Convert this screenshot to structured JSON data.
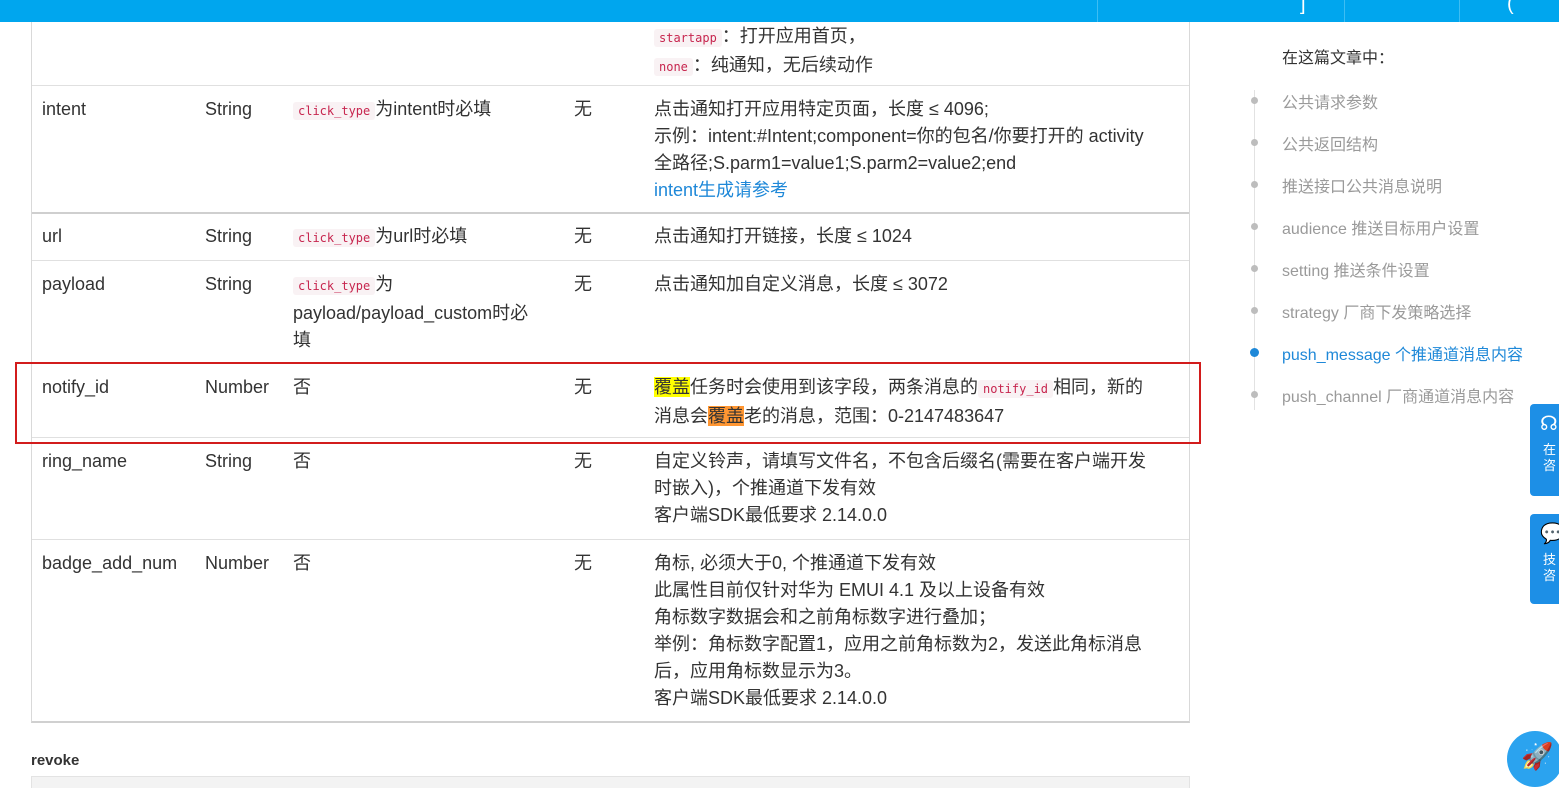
{
  "topbar": {
    "right_glyph_1": "]",
    "right_glyph_2": "("
  },
  "table": {
    "partial_row": {
      "line1_code": "startapp",
      "line1_text": "：打开应用首页，",
      "line2_code": "none",
      "line2_text": "：纯通知，无后续动作"
    },
    "rows": [
      {
        "name": "intent",
        "type": "String",
        "required_code": "click_type",
        "required_text": "为intent时必填",
        "default": "无",
        "desc": [
          "点击通知打开应用特定页面，长度 ≤ 4096;",
          "示例：intent:#Intent;component=你的包名/你要打开的 activity",
          "全路径;S.parm1=value1;S.parm2=value2;end"
        ],
        "link": "intent生成请参考"
      },
      {
        "name": "url",
        "type": "String",
        "required_code": "click_type",
        "required_text": "为url时必填",
        "default": "无",
        "desc": [
          "点击通知打开链接，长度 ≤ 1024"
        ]
      },
      {
        "name": "payload",
        "type": "String",
        "required_code": "click_type",
        "required_text": "为",
        "required_text2": "payload/payload_custom时必",
        "required_text3": "填",
        "default": "无",
        "desc": [
          "点击通知加自定义消息，长度 ≤ 3072"
        ]
      },
      {
        "name": "notify_id",
        "type": "Number",
        "required": "否",
        "default": "无",
        "desc_a": "覆盖",
        "desc_b": "任务时会使用到该字段，两条消息的",
        "desc_code": "notify_id",
        "desc_c": "相同，新的",
        "desc2_a": "消息会",
        "desc2_b": "覆盖",
        "desc2_c": "老的消息，范围：0-2147483647"
      },
      {
        "name": "ring_name",
        "type": "String",
        "required": "否",
        "default": "无",
        "desc": [
          "自定义铃声，请填写文件名，不包含后缀名(需要在客户端开发",
          "时嵌入)，个推通道下发有效",
          "客户端SDK最低要求 2.14.0.0"
        ]
      },
      {
        "name": "badge_add_num",
        "type": "Number",
        "required": "否",
        "default": "无",
        "desc": [
          "角标, 必须大于0, 个推通道下发有效",
          "此属性目前仅针对华为 EMUI 4.1 及以上设备有效",
          "角标数字数据会和之前角标数字进行叠加；",
          "举例：角标数字配置1，应用之前角标数为2，发送此角标消息",
          "后，应用角标数显示为3。",
          "客户端SDK最低要求 2.14.0.0"
        ]
      }
    ]
  },
  "revoke_heading": "revoke",
  "toc": {
    "title": "在这篇文章中：",
    "items": [
      {
        "label": "公共请求参数",
        "active": false
      },
      {
        "label": "公共返回结构",
        "active": false
      },
      {
        "label": "推送接口公共消息说明",
        "active": false
      },
      {
        "label": "audience 推送目标用户设置",
        "active": false
      },
      {
        "label": "setting 推送条件设置",
        "active": false
      },
      {
        "label": "strategy 厂商下发策略选择",
        "active": false
      },
      {
        "label": "push_message 个推通道消息内容",
        "active": true
      },
      {
        "label": "push_channel 厂商通道消息内容",
        "active": false
      }
    ]
  },
  "float_buttons": [
    {
      "icon": "headset-icon",
      "label_1": "在",
      "label_2": "咨"
    },
    {
      "icon": "chat-icon",
      "label_1": "技",
      "label_2": "咨"
    }
  ],
  "colors": {
    "topbar": "#00a6ee",
    "accent": "#1e88d8",
    "highlight_box": "#d21c1c"
  }
}
